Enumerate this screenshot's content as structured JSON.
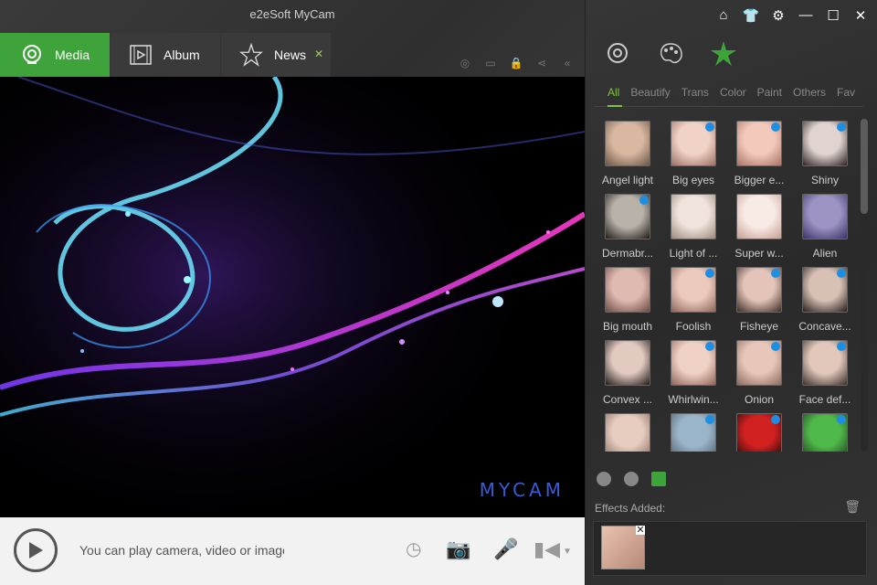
{
  "window": {
    "title": "e2eSoft MyCam"
  },
  "tabs": [
    {
      "label": "Media",
      "icon": "webcam-icon"
    },
    {
      "label": "Album",
      "icon": "film-icon"
    },
    {
      "label": "News",
      "icon": "star-icon"
    }
  ],
  "preview": {
    "brand": "MYCAM"
  },
  "bottom": {
    "message": "You can play camera, video or image"
  },
  "filters": [
    "All",
    "Beautify",
    "Trans",
    "Color",
    "Paint",
    "Others",
    "Fav"
  ],
  "effects": [
    {
      "label": "Angel light",
      "dot": false,
      "colors": [
        "#d9b7a0",
        "#6a5648"
      ]
    },
    {
      "label": "Big eyes",
      "dot": true,
      "colors": [
        "#f1d2c7",
        "#9b6f62"
      ]
    },
    {
      "label": "Bigger e...",
      "dot": true,
      "colors": [
        "#f3c9bc",
        "#a87464"
      ]
    },
    {
      "label": "Shiny",
      "dot": true,
      "colors": [
        "#e0d3d0",
        "#2c2222"
      ]
    },
    {
      "label": "Dermabr...",
      "dot": true,
      "colors": [
        "#b9b2a9",
        "#1f1b18"
      ]
    },
    {
      "label": "Light of ...",
      "dot": false,
      "colors": [
        "#efe3dc",
        "#9c8a7a"
      ]
    },
    {
      "label": "Super w...",
      "dot": false,
      "colors": [
        "#f8eae4",
        "#c59f92"
      ]
    },
    {
      "label": "Alien",
      "dot": false,
      "colors": [
        "#9d94c4",
        "#3a3268"
      ]
    },
    {
      "label": "Big mouth",
      "dot": false,
      "colors": [
        "#dfbab0",
        "#6b4a44"
      ]
    },
    {
      "label": "Foolish",
      "dot": true,
      "colors": [
        "#ecc9bd",
        "#8c6459"
      ]
    },
    {
      "label": "Fisheye",
      "dot": true,
      "colors": [
        "#e4c4b8",
        "#3b2b27"
      ]
    },
    {
      "label": "Concave...",
      "dot": true,
      "colors": [
        "#d8c0b4",
        "#251d1b"
      ]
    },
    {
      "label": "Convex ...",
      "dot": false,
      "colors": [
        "#e3cac0",
        "#1f1a19"
      ]
    },
    {
      "label": "Whirlwin...",
      "dot": true,
      "colors": [
        "#f0d1c5",
        "#8e6358"
      ]
    },
    {
      "label": "Onion",
      "dot": true,
      "colors": [
        "#e9c6ba",
        "#8c6a5f"
      ]
    },
    {
      "label": "Face def...",
      "dot": true,
      "colors": [
        "#e2c7bb",
        "#3a2f2b"
      ]
    },
    {
      "label": "",
      "dot": false,
      "colors": [
        "#e6cdbf",
        "#8a6d61"
      ]
    },
    {
      "label": "",
      "dot": true,
      "colors": [
        "#9ab4c9",
        "#52606b"
      ]
    },
    {
      "label": "",
      "dot": true,
      "colors": [
        "#d12020",
        "#1a0a0a"
      ]
    },
    {
      "label": "",
      "dot": true,
      "colors": [
        "#4fb84a",
        "#1e3b1d"
      ]
    }
  ],
  "effects_panel": {
    "label": "Effects Added:"
  },
  "colors": {
    "accent": "#3ea33a",
    "dot": "#1e8fe0"
  }
}
